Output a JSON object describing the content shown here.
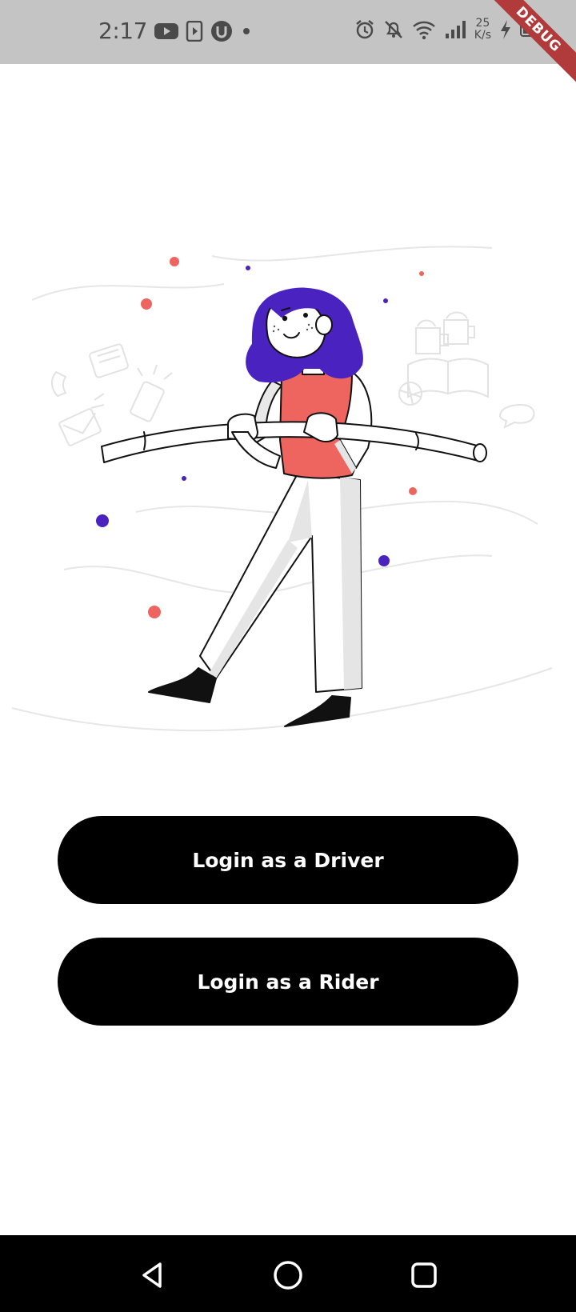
{
  "status_bar": {
    "time": "2:17",
    "net_speed_value": "25",
    "net_speed_unit": "K/s",
    "left_icons": [
      "youtube-icon",
      "media-icon",
      "vpn-icon",
      "dot-icon"
    ],
    "right_icons": [
      "alarm-icon",
      "mute-icon",
      "wifi-icon",
      "signal-icon",
      "charging-icon",
      "battery-icon"
    ]
  },
  "debug_banner": {
    "label": "DEBUG"
  },
  "buttons": {
    "driver_label": "Login as a Driver",
    "rider_label": "Login as a Rider"
  },
  "nav_bar": {
    "items": [
      "back-icon",
      "home-icon",
      "recents-icon"
    ]
  },
  "colors": {
    "accent_purple": "#4a22c0",
    "accent_coral": "#ee6560",
    "button_bg": "#000000",
    "status_bar_bg": "#c4c4c4"
  }
}
